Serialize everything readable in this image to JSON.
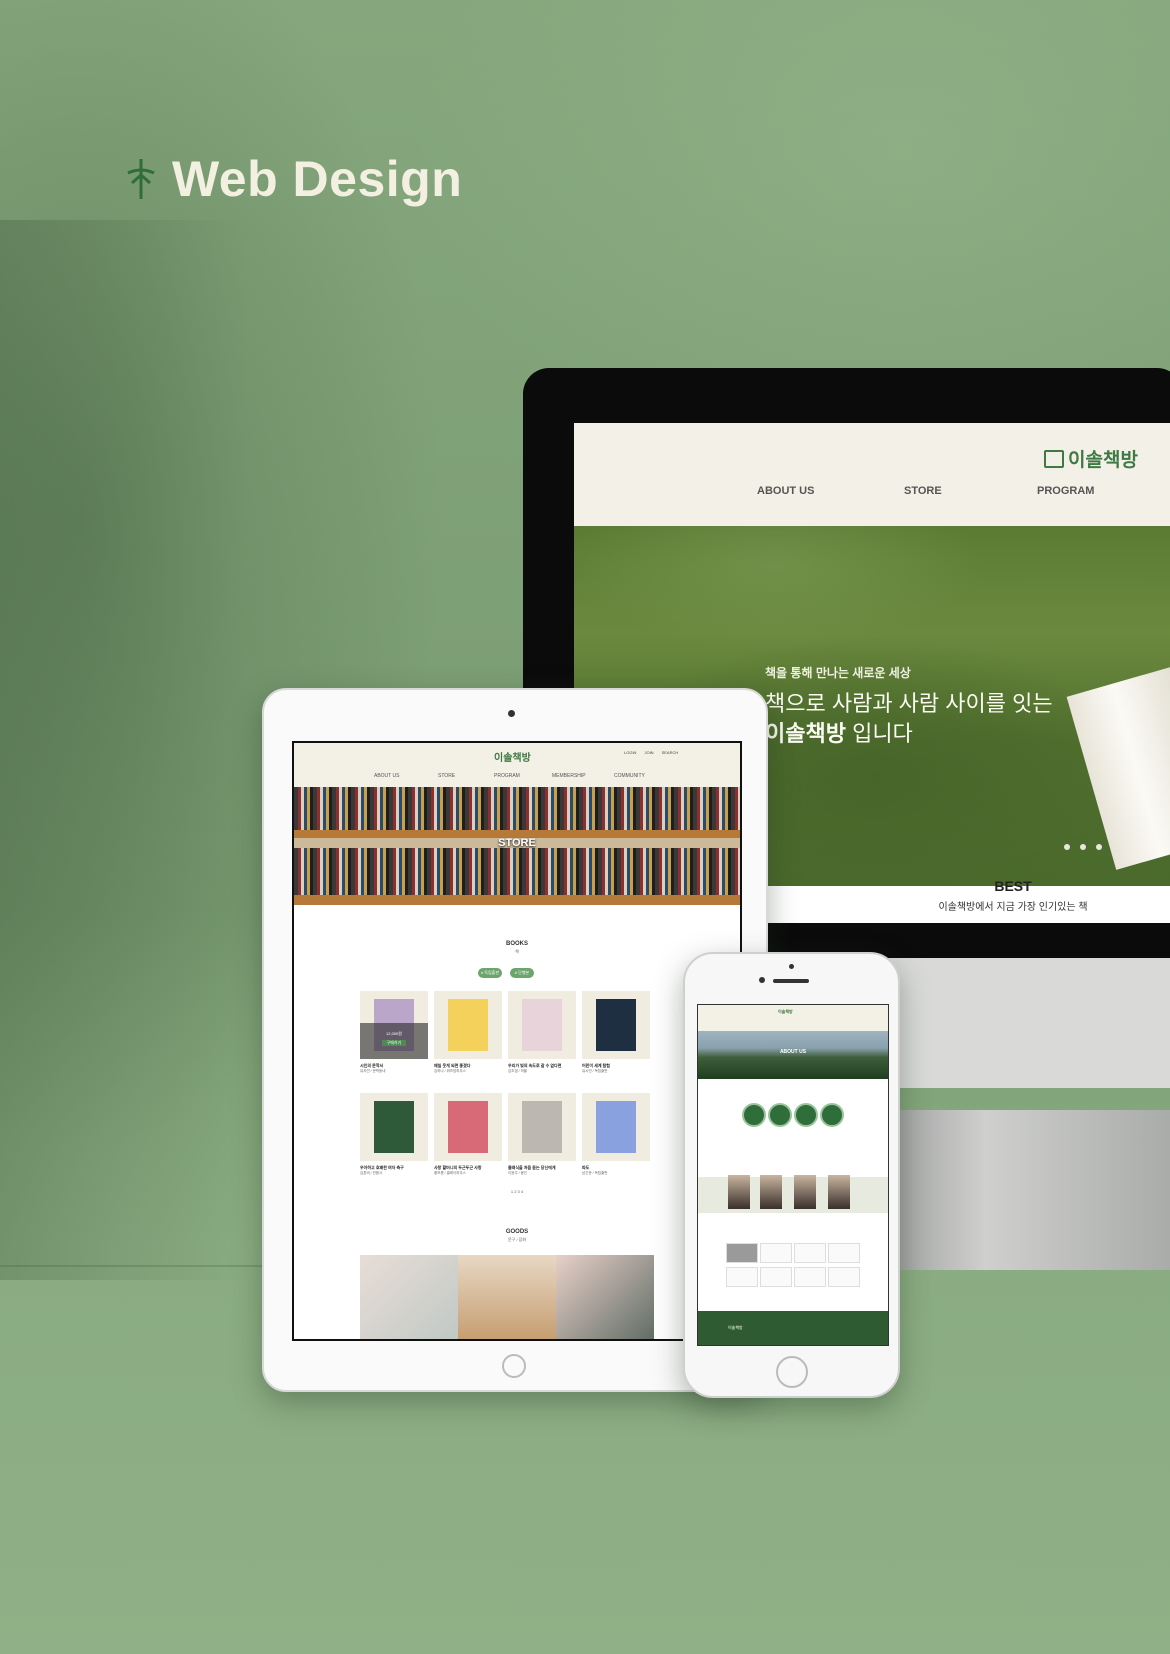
{
  "page_title": "Web Design",
  "brand": {
    "name": "이솔책방",
    "accent": "#3f7a44",
    "bg": "#7e9f76"
  },
  "monitor": {
    "nav": [
      "ABOUT US",
      "STORE",
      "PROGRAM"
    ],
    "hero": {
      "sub": "책을 통해 만나는 새로운 세상",
      "line1": "책으로 사람과 사람 사이를 잇는",
      "line2_brand": "이솔책방",
      "line2_rest": " 입니다"
    },
    "best_title": "BEST",
    "best_sub": "이솔책방에서 지금 가장 인기있는 책"
  },
  "tablet": {
    "logo": "이솔책방",
    "icons": [
      "LOGIN",
      "JOIN",
      "SEARCH"
    ],
    "nav": [
      "ABOUT US",
      "STORE",
      "PROGRAM",
      "MEMBERSHIP",
      "COMMUNITY"
    ],
    "hero_label": "STORE",
    "books_title": "BOOKS",
    "books_sub": "책",
    "pills": [
      "# 독립출판",
      "# 단행본"
    ],
    "books": [
      {
        "title": "시인의 문학서",
        "author": "유지민 / 문학동네",
        "price": "12,000원",
        "cta": "구매하기",
        "color": "#b9a6c8"
      },
      {
        "title": "매일 웃게 되면 좋겠다",
        "author": "김하나 / 위즈덤하우스",
        "color": "#f3d15a"
      },
      {
        "title": "우리가 빛의 속도로 갈 수 없다면",
        "author": "김초엽 / 허블",
        "color": "#e8d3da"
      },
      {
        "title": "어린이 세계 탐험",
        "author": "유시민 / 독립출판",
        "color": "#1d2f40"
      },
      {
        "title": "우아하고 호쾌한 여자 축구",
        "author": "김혼비 / 민음사",
        "color": "#2f5a3a"
      },
      {
        "title": "사랑 할머니의 두근두근 사랑",
        "author": "황보름 / 클레이하우스",
        "color": "#d86a78"
      },
      {
        "title": "클래식을 처음 듣는 당신에게",
        "author": "이윤주 / 웅진",
        "color": "#bcb7b0"
      },
      {
        "title": "파도",
        "author": "남긴문 / 독립출판",
        "color": "#8aa1df"
      }
    ],
    "pagination": "1 2 3 4",
    "goods_title": "GOODS",
    "goods_sub": "문구 / 잡화"
  },
  "phone": {
    "logo": "이솔책방",
    "hero_label": "ABOUT US",
    "footer_logo": "이솔책방"
  }
}
